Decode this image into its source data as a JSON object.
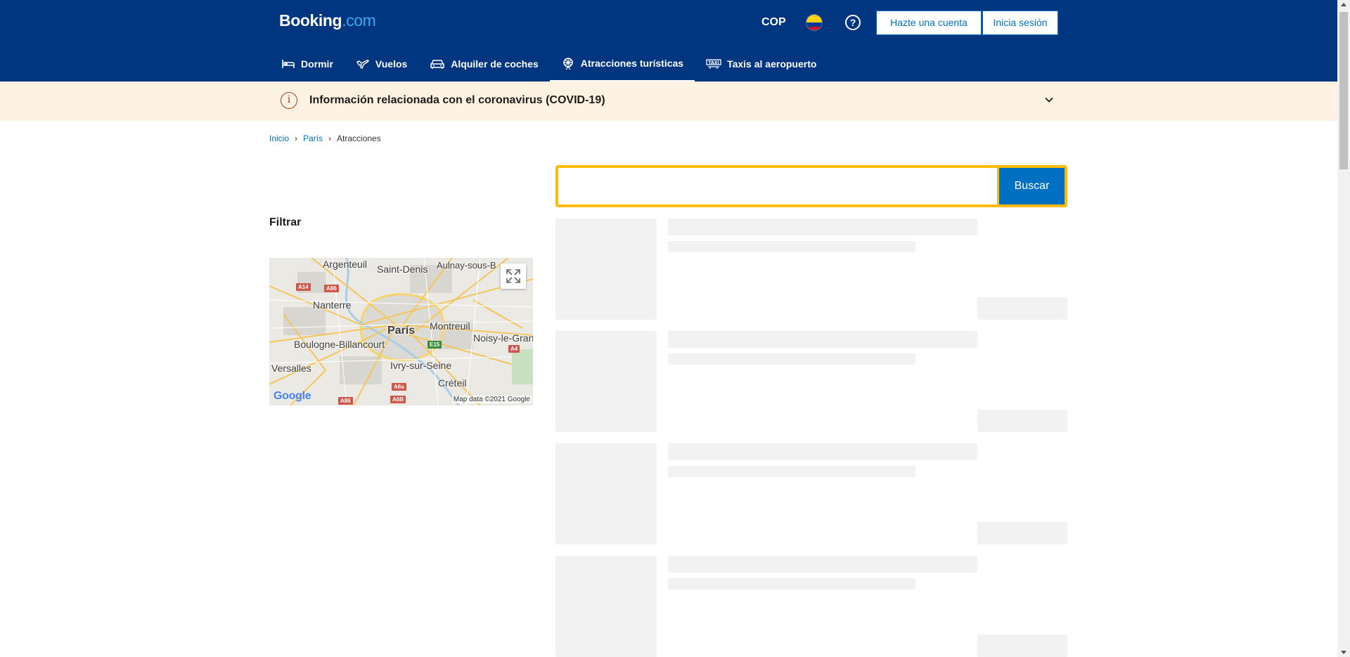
{
  "header": {
    "logo": {
      "main": "Booking",
      "suffix": ".com"
    },
    "currency": "COP",
    "help_icon": "?",
    "signup_label": "Hazte una cuenta",
    "signin_label": "Inicia sesión",
    "nav": [
      {
        "label": "Dormir",
        "icon": "bed-icon",
        "active": false
      },
      {
        "label": "Vuelos",
        "icon": "plane-icon",
        "active": false
      },
      {
        "label": "Alquiler de coches",
        "icon": "car-icon",
        "active": false
      },
      {
        "label": "Atracciones turísticas",
        "icon": "attractions-icon",
        "active": true
      },
      {
        "label": "Taxis al aeropuerto",
        "icon": "taxi-icon",
        "active": false
      }
    ]
  },
  "banner": {
    "icon": "i",
    "text": "Información relacionada con el coronavirus (COVID-19)"
  },
  "breadcrumb": {
    "items": [
      "Inicio",
      "París"
    ],
    "current": "Atracciones"
  },
  "search": {
    "value": "",
    "button_label": "Buscar"
  },
  "filter_title": "Filtrar",
  "map": {
    "labels": [
      "Argenteuil",
      "Saint-Denis",
      "Aulnay-sous-B",
      "Nanterre",
      "París",
      "Montreuil",
      "Noisy-le-Granc",
      "Boulogne-Billancourt",
      "Versalles",
      "Ivry-sur-Seine",
      "Créteil"
    ],
    "shields": [
      "A14",
      "A86",
      "E15",
      "A4",
      "A6a",
      "A86",
      "A6B"
    ],
    "logo": "Google",
    "credit": "Map data ©2021 Google"
  },
  "colors": {
    "brand": "#003580",
    "accent": "#0071c2",
    "search_border": "#febb02",
    "banner_bg": "#fef3e3"
  },
  "skeleton_cards": 4
}
